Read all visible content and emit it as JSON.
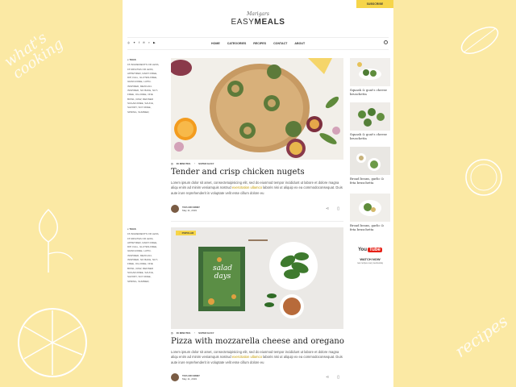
{
  "header": {
    "subscribe_label": "SUBSCRIBE",
    "logo_script": "Marigars",
    "logo_main_light": "EASY",
    "logo_main_bold": "MEALS"
  },
  "social_icons": [
    "instagram-icon",
    "twitter-icon",
    "facebook-icon",
    "pinterest-icon",
    "rss-icon",
    "youtube-icon"
  ],
  "social_glyphs": [
    "◎",
    "✦",
    "f",
    "℗",
    "◗",
    "▶"
  ],
  "nav": {
    "items": [
      "HOME",
      "CATEGORIES",
      "RECIPES",
      "CONTACT",
      "ABOUT"
    ]
  },
  "background": {
    "top_left_text": "what's cooking",
    "bottom_right_text": "recipes"
  },
  "tags": {
    "title": "TAGS",
    "items": [
      "15 INGREDIENTS OR LESS,",
      "15 MINUTES OR LESS,",
      "APPETIZER,",
      "DAIRY-FREE,",
      "DIP,",
      "FALL,",
      "GLUTEN-FREE,",
      "GRAIN-FREE,",
      "LATIN-INSPIRED,",
      "MEXICAN-INSPIRED,",
      "NO BAKE,",
      "NUT-FREE,",
      "OIL-FREE,",
      "ONE BOWL,",
      "RAW,",
      "REFINED SUGAR-FREE,",
      "SAUCE,",
      "SAVORY,",
      "SOY-FREE,",
      "SPRING,",
      "SUMMER,"
    ]
  },
  "posts": [
    {
      "time": "30 MINUTES",
      "difficulty": "SUPER EASY",
      "title": "Tender and crisp chicken nugets",
      "excerpt_1": "Lorem ipsum dolor sit amet, consectetuipisicing elit, sed do eiusmod tempor incididunt ut labore et dolore magna aliqu",
      "excerpt_hl": "exercitation ullamco",
      "excerpt_a": "enim ad minim veniamquis nostrud",
      "excerpt_2": "laboris nisi ut aliquip ex ea commodoconsequat. Duis aute irure reprehenderit in voluptate velit esse cillum dolore eu",
      "author_name": "TAYLOR KINNY",
      "author_date": "May 11, 2019"
    },
    {
      "badge": "POPULAR",
      "time": "30 MINUTES",
      "difficulty": "SUPER EASY",
      "title": "Pizza with mozzarella cheese and oregano",
      "excerpt_1": "Lorem ipsum dolor sit amet, consectetuipisicing elit, sed do eiusmod tempor incididunt ut labore et dolore magna aliqu",
      "excerpt_hl": "exercitation ullamco",
      "excerpt_a": "enim ad minim veniamquis nostrud",
      "excerpt_2": "laboris nisi ut aliquip ex ea commodoconsequat. Duis aute irure reprehenderit in voluptate velit esse cillum dolore eu",
      "author_name": "TAYLOR KINNY",
      "author_date": "May 11, 2019",
      "book_text": "salad days"
    }
  ],
  "sidebar": {
    "items": [
      {
        "title": "Squash & goat's cheese bruschetta"
      },
      {
        "title": "Squash & goat's cheese bruschetta"
      },
      {
        "title": "Broad beans, garlic & feta bruschetta"
      },
      {
        "title": "Broad beans, garlic & feta bruschetta"
      }
    ],
    "youtube": {
      "you": "You",
      "tube": "Tube",
      "watch": "WATCH NOW",
      "sub": "new recipes every wednesday"
    }
  }
}
